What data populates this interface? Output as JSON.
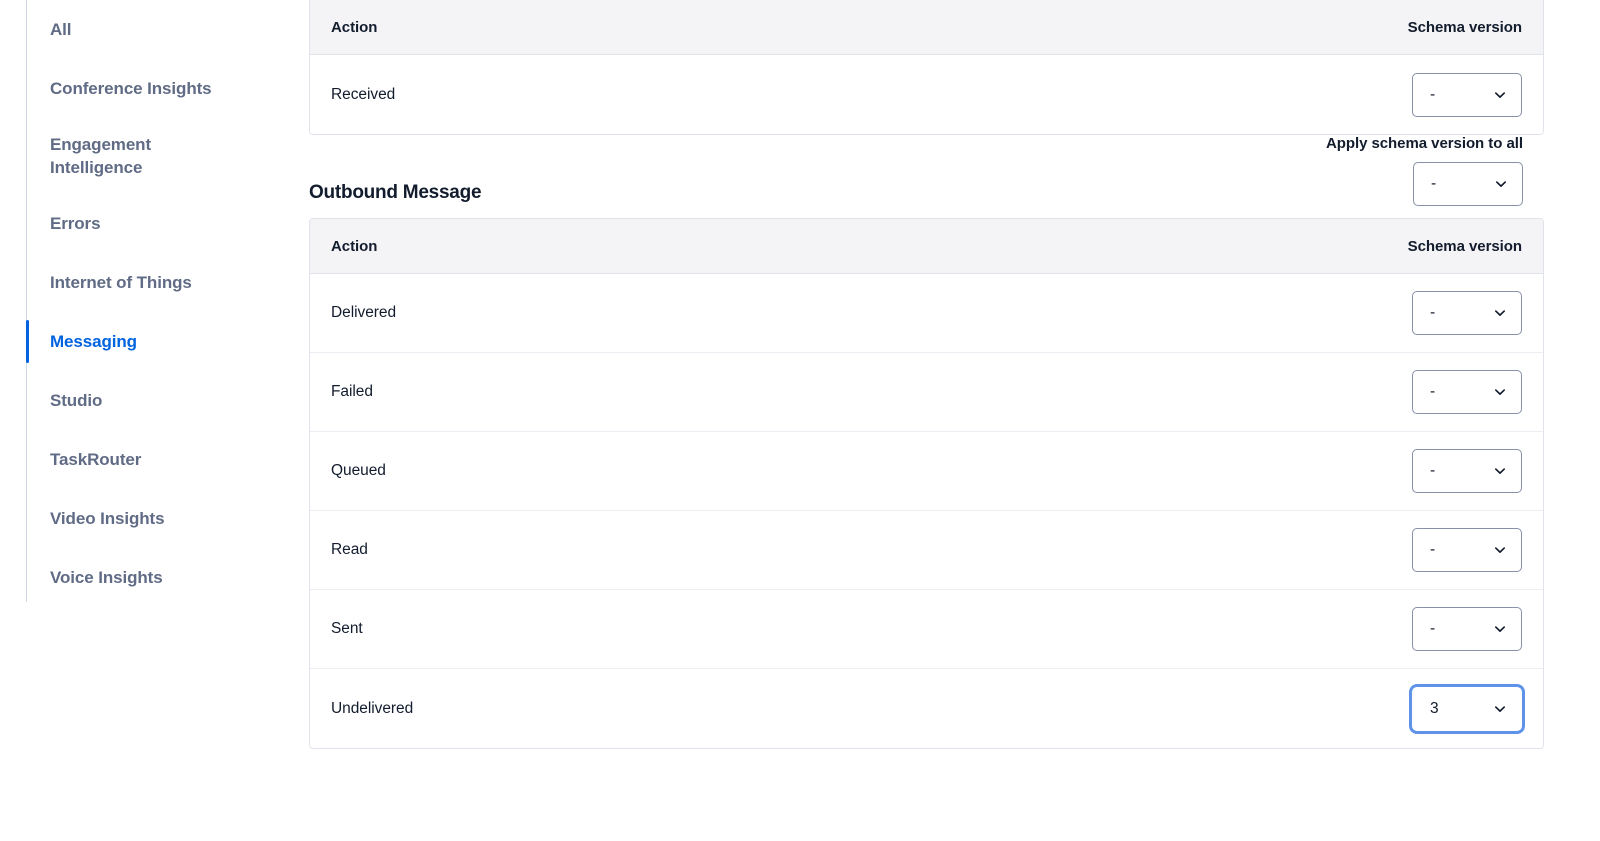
{
  "sidebar": {
    "items": [
      {
        "label": "All",
        "active": false,
        "multiline": false
      },
      {
        "label": "Conference Insights",
        "active": false,
        "multiline": false
      },
      {
        "label": "Engagement\nIntelligence",
        "active": false,
        "multiline": true
      },
      {
        "label": "Errors",
        "active": false,
        "multiline": false
      },
      {
        "label": "Internet of Things",
        "active": false,
        "multiline": false
      },
      {
        "label": "Messaging",
        "active": true,
        "multiline": false
      },
      {
        "label": "Studio",
        "active": false,
        "multiline": false
      },
      {
        "label": "TaskRouter",
        "active": false,
        "multiline": false
      },
      {
        "label": "Video Insights",
        "active": false,
        "multiline": false
      },
      {
        "label": "Voice Insights",
        "active": false,
        "multiline": false
      }
    ]
  },
  "columns": {
    "action": "Action",
    "schema_version": "Schema version"
  },
  "inbound_table": {
    "rows": [
      {
        "action": "Received",
        "schema_version": "-",
        "focused": false
      }
    ]
  },
  "apply_all": {
    "label": "Apply schema version to all",
    "value": "-"
  },
  "outbound_section": {
    "title": "Outbound Message"
  },
  "outbound_table": {
    "rows": [
      {
        "action": "Delivered",
        "schema_version": "-",
        "focused": false
      },
      {
        "action": "Failed",
        "schema_version": "-",
        "focused": false
      },
      {
        "action": "Queued",
        "schema_version": "-",
        "focused": false
      },
      {
        "action": "Read",
        "schema_version": "-",
        "focused": false
      },
      {
        "action": "Sent",
        "schema_version": "-",
        "focused": false
      },
      {
        "action": "Undelivered",
        "schema_version": "3",
        "focused": true
      }
    ]
  },
  "icons": {
    "chevron_down": "chevron-down-icon"
  },
  "colors": {
    "accent": "#0263e0",
    "sidebar_text": "#606b85",
    "text": "#121c2d",
    "header_bg": "#f4f4f6",
    "border": "#e1e3ea",
    "row_border": "#eceef3",
    "select_border": "#8891aa",
    "focus_ring": "#5f93e9"
  }
}
